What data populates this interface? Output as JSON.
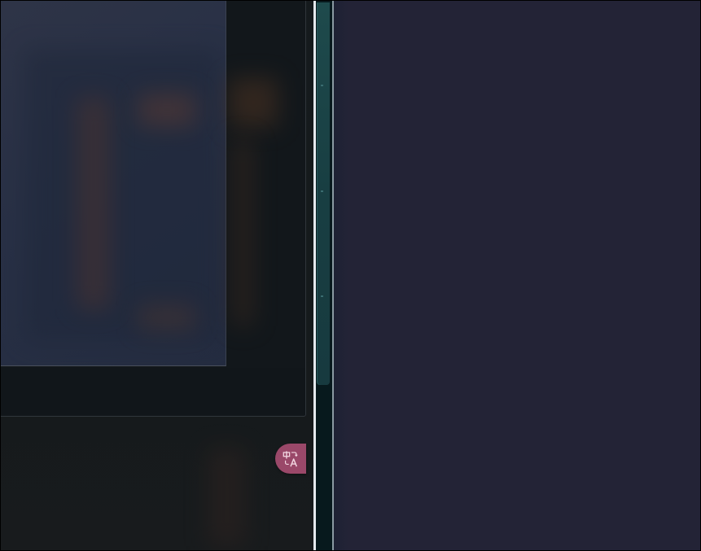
{
  "colors": {
    "left_background": "#15191c",
    "dialog_preview": "#2a3145",
    "divider_light": "#e4e9ee",
    "scrollbar_thumb": "#1b4446",
    "right_background": "#232336",
    "translate_badge": "#9a4869"
  },
  "icons": {
    "translate": "translate-icon"
  }
}
